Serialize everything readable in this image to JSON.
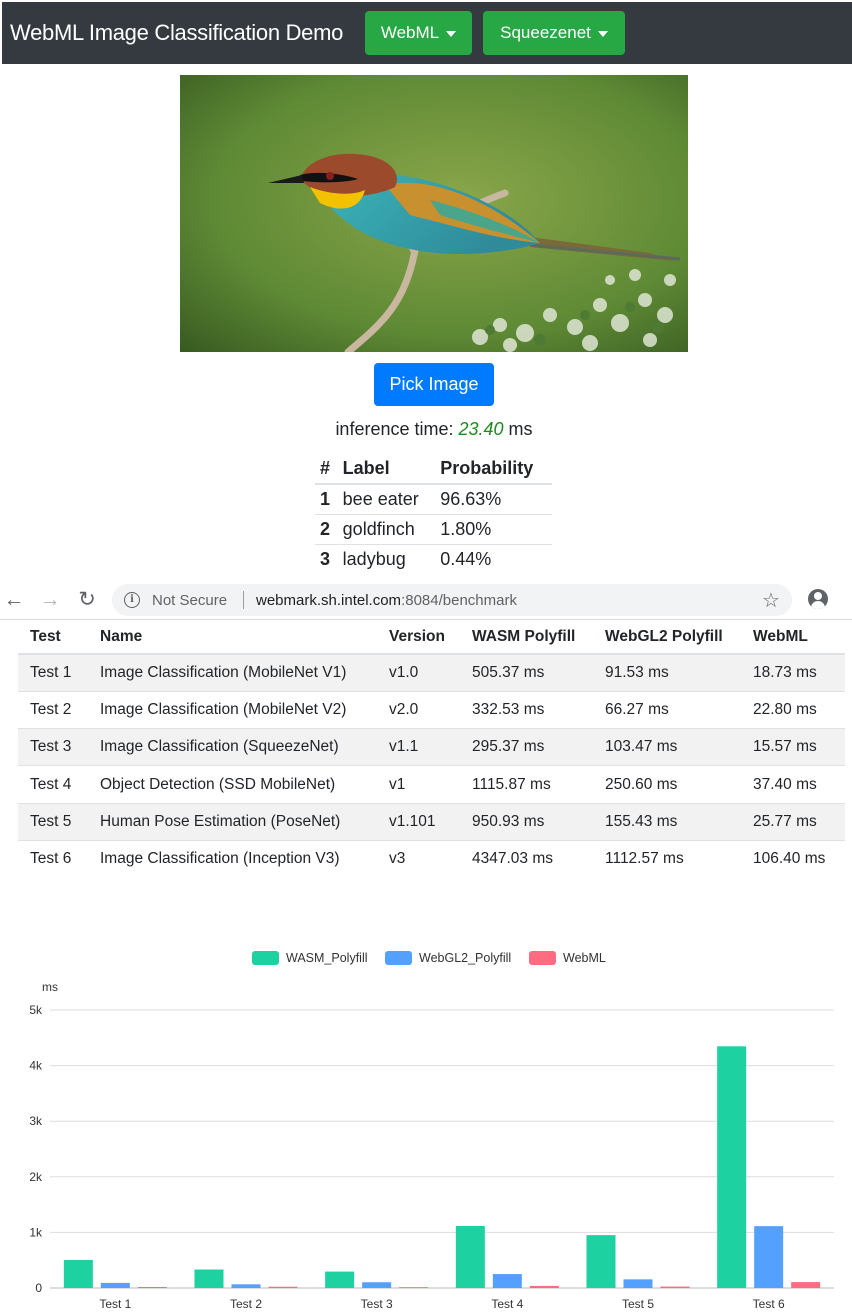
{
  "navbar": {
    "brand": "WebML Image Classification Demo",
    "backend_label": "WebML",
    "model_label": "Squeezenet"
  },
  "main": {
    "pick_label": "Pick Image",
    "inference_prefix": "inference time: ",
    "inference_value": "23.40",
    "inference_unit": " ms"
  },
  "results": {
    "headers": [
      "#",
      "Label",
      "Probability"
    ],
    "rows": [
      {
        "rank": "1",
        "label": "bee eater",
        "prob": "96.63%"
      },
      {
        "rank": "2",
        "label": "goldfinch",
        "prob": "1.80%"
      },
      {
        "rank": "3",
        "label": "ladybug",
        "prob": "0.44%"
      }
    ]
  },
  "browser": {
    "security": "Not Secure",
    "url_host": "webmark.sh.intel.com",
    "url_rest": ":8084/benchmark"
  },
  "benchmark": {
    "headers": [
      "Test",
      "Name",
      "Version",
      "WASM Polyfill",
      "WebGL2 Polyfill",
      "WebML"
    ],
    "rows": [
      [
        "Test 1",
        "Image Classification (MobileNet V1)",
        "v1.0",
        "505.37 ms",
        "91.53 ms",
        "18.73 ms"
      ],
      [
        "Test 2",
        "Image Classification (MobileNet V2)",
        "v2.0",
        "332.53 ms",
        "66.27 ms",
        "22.80 ms"
      ],
      [
        "Test 3",
        "Image Classification (SqueezeNet)",
        "v1.1",
        "295.37 ms",
        "103.47 ms",
        "15.57 ms"
      ],
      [
        "Test 4",
        "Object Detection (SSD MobileNet)",
        "v1",
        "1115.87 ms",
        "250.60 ms",
        "37.40 ms"
      ],
      [
        "Test 5",
        "Human Pose Estimation (PoseNet)",
        "v1.101",
        "950.93 ms",
        "155.43 ms",
        "25.77 ms"
      ],
      [
        "Test 6",
        "Image Classification (Inception V3)",
        "v3",
        "4347.03 ms",
        "1112.57 ms",
        "106.40 ms"
      ]
    ]
  },
  "chart_data": {
    "type": "bar",
    "categories": [
      "Test 1",
      "Test 2",
      "Test 3",
      "Test 4",
      "Test 5",
      "Test 6"
    ],
    "series": [
      {
        "name": "WASM_Polyfill",
        "color": "#1dd1a1",
        "values": [
          505.37,
          332.53,
          295.37,
          1115.87,
          950.93,
          4347.03
        ]
      },
      {
        "name": "WebGL2_Polyfill",
        "color": "#54a0ff",
        "values": [
          91.53,
          66.27,
          103.47,
          250.6,
          155.43,
          1112.57
        ]
      },
      {
        "name": "WebML",
        "color": "#ff6b81",
        "values": [
          18.73,
          22.8,
          15.57,
          37.4,
          25.77,
          106.4
        ]
      }
    ],
    "ylabel": "ms",
    "ylim": [
      0,
      5000
    ],
    "yticks": [
      "0",
      "1k",
      "2k",
      "3k",
      "4k",
      "5k"
    ],
    "grid": true,
    "legend": "top-center"
  }
}
